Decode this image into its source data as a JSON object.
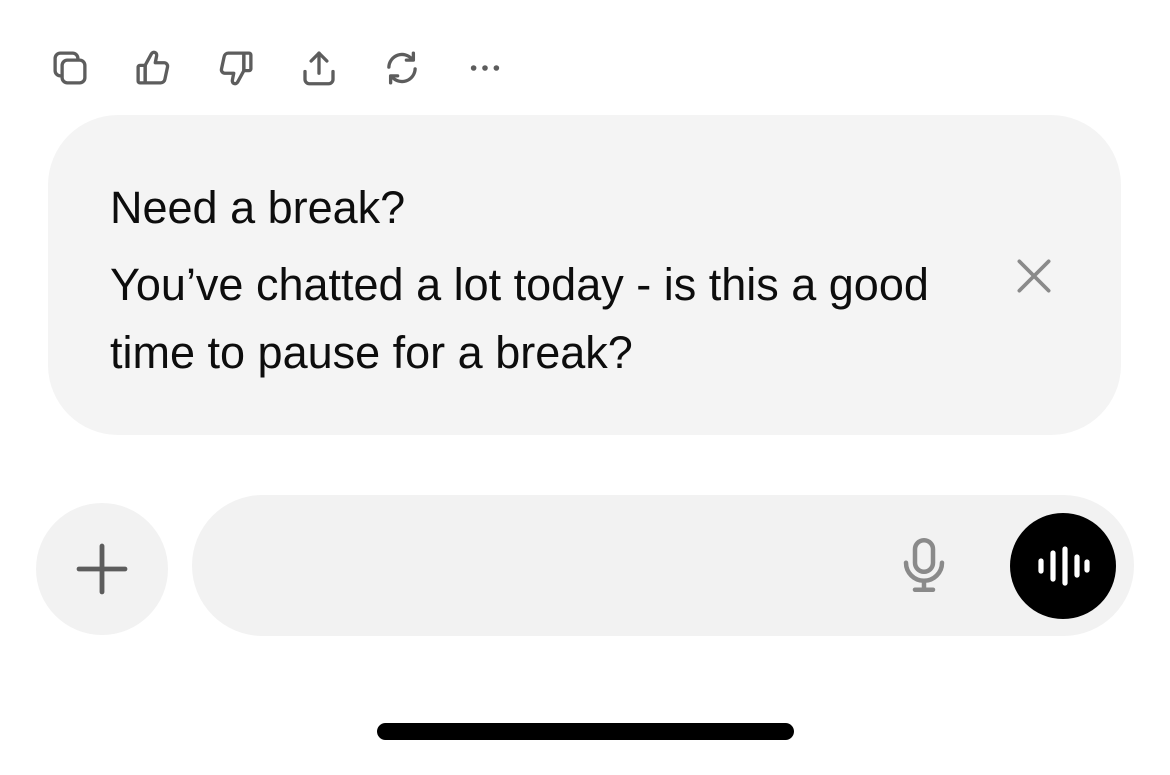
{
  "toolbar": {
    "actions": [
      {
        "name": "copy",
        "icon": "copy-icon"
      },
      {
        "name": "good-response",
        "icon": "thumbs-up-icon"
      },
      {
        "name": "bad-response",
        "icon": "thumbs-down-icon"
      },
      {
        "name": "share",
        "icon": "share-icon"
      },
      {
        "name": "regenerate",
        "icon": "refresh-icon"
      },
      {
        "name": "more",
        "icon": "more-icon"
      }
    ]
  },
  "nudge": {
    "title": "Need a break?",
    "body": "You’ve chatted a lot today - is this a good time to pause for a break?",
    "close_icon": "close-icon"
  },
  "composer": {
    "value": "",
    "placeholder": "",
    "plus_icon": "plus-icon",
    "mic_icon": "microphone-icon",
    "voice_icon": "voice-waveform-icon"
  },
  "colors": {
    "card_background": "#f4f4f4",
    "composer_background": "#f2f2f2",
    "icon_gray": "#5d5d5d",
    "muted_gray": "#8a8a8a",
    "voice_button": "#000000"
  }
}
